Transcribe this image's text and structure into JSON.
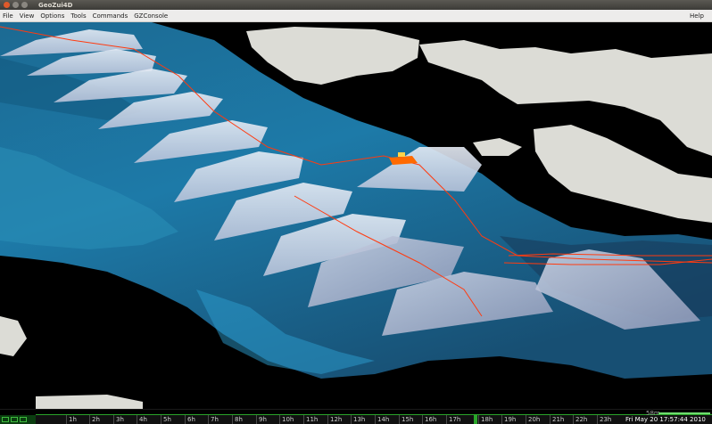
{
  "window": {
    "title": "GeoZui4D"
  },
  "menu": {
    "items": [
      "File",
      "View",
      "Options",
      "Tools",
      "Commands",
      "GZConsole"
    ],
    "help": "Help"
  },
  "timeline": {
    "hours": [
      "1h",
      "2h",
      "3h",
      "4h",
      "5h",
      "6h",
      "7h",
      "8h",
      "9h",
      "10h",
      "11h",
      "12h",
      "13h",
      "14h",
      "15h",
      "16h",
      "17h",
      "18h",
      "19h",
      "20h",
      "21h",
      "22h",
      "23h"
    ],
    "datetime": "Fri May 20 17:57:44 2010",
    "scale": "58m"
  },
  "colors": {
    "seafloor": "#1d6e9a",
    "land": "#dcdcd6",
    "track": "#ff3b10",
    "marker": "#2aa52a"
  }
}
